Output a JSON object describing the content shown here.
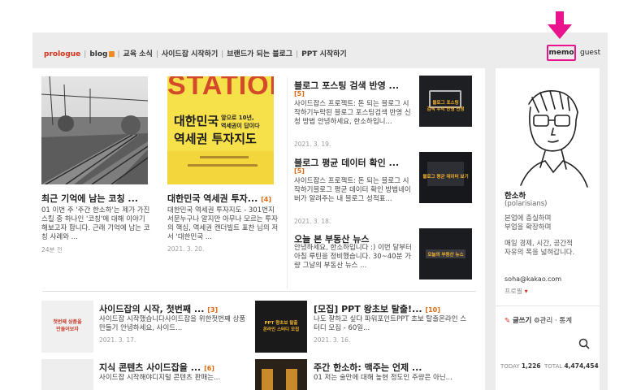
{
  "nav": {
    "items": [
      "prologue",
      "blog",
      "교육 소식",
      "사이드잡 시작하기",
      "브랜드가 되는 블로그",
      "PPT 시작하기"
    ],
    "memo": "memo",
    "guest": "guest"
  },
  "featured": [
    {
      "title": "최근 기억에 남는 코칭 ...",
      "count": "",
      "excerpt": "01 이번 주 '주간 한소하'는 제가 가진 스킬 중 하나인 '코칭'에 대해 이야기해보고자 합니다. 근래 기억에 남는 코칭 사례와 ...",
      "date": "24분 전"
    },
    {
      "title": "대한민국 역세권 투자...",
      "count": "[4]",
      "excerpt": "대한민국 역세권 투자지도 - 301번지 서문누구나 알지만 아무나 모르는 투자의 핵심, 역세권 캔더빌트 표찬 님의 저서 '대한민국 ...",
      "date": "2021. 3. 20.",
      "cover_top": "STATION",
      "cover_main": "대한민국\n역세권 투자지도",
      "cover_side": "앞으로 10년,\n역세권이 답이다"
    }
  ],
  "right_posts": [
    {
      "title": "블로그 포스팅 검색 반영 ...",
      "count": "[5]",
      "excerpt": "사이드잡스 프로젝트: 돈 되는 블로그 시작하기누락된 블로그 포스팅검색 반영 신청 방법 안녕하세요, 한소하입니...",
      "date": "2021. 3. 19.",
      "thumb_text": "블로그 포스팅\n검색 누락 반영 신청"
    },
    {
      "title": "블로그 평균 데이터 확인 ...",
      "count": "[5]",
      "excerpt": "사이드잡스 프로젝트: 돈 되는 블로그 시작하기블로그 평균 데이터 확인 방법네이버가 알려주는 내 블로그 성적표...",
      "date": "2021. 3. 18.",
      "thumb_text": "블로그 평균 데이터 보기"
    },
    {
      "title": "오늘 본 부동산 뉴스",
      "count": "",
      "excerpt": "안녕하세요, 한소하입니다 :) 이번 달부터 아침 루틴을 정비했습니다. 30~40분 가량 그날의 부동산 뉴스 ...",
      "date": "2021. 3. 18.",
      "thumb_text": "오늘의 부동산 뉴스"
    }
  ],
  "list_posts": [
    {
      "title": "사이드잡의 시작, 첫번째 ...",
      "count": "[3]",
      "excerpt": "사이드잡 시작했습니다사이드잡을 위한첫번째 상품 만들기 안녕하세요, 사이드...",
      "date": "2021. 3. 17.",
      "thumb_text": "첫번째 상품을\n만들어보자"
    },
    {
      "title": "[모집] PPT 왕초보 탈출!...",
      "count": "[10]",
      "excerpt": "나도 잘하고 싶다 파워포인트PPT 초보 탈출온라인 스터디 모집 - 60일...",
      "date": "2021. 3. 16.",
      "thumb_text": "PPT 왕초보 탈출\n온라인 스터디 모집"
    },
    {
      "title": "지식 콘텐츠 사이드잡을 ...",
      "count": "[6]",
      "excerpt": "사이드잡 시작해야디지털 콘텐츠 판매는...",
      "date": "",
      "thumb_text": ""
    },
    {
      "title": "주간 한소하: 맥주는 언제 ...",
      "count": "",
      "excerpt": "01 저는 술만에 대해 높현 정도인 주량은 아닌...",
      "date": "",
      "thumb_text": ""
    }
  ],
  "sidebar": {
    "name": "한소하",
    "id": "(polarisians)",
    "desc1": "본업에 충실하며\n부업을 확장하며",
    "desc2": "매일 경제, 시간, 공간적\n자유의 폭을 넓혀갑니다.",
    "email": "soha@kakao.com",
    "profile": "프로필",
    "write": "글쓰기",
    "admin": "관리 · 통계",
    "today_label": "TODAY",
    "today": "1,226",
    "total_label": "TOTAL",
    "total": "4,474,454"
  }
}
